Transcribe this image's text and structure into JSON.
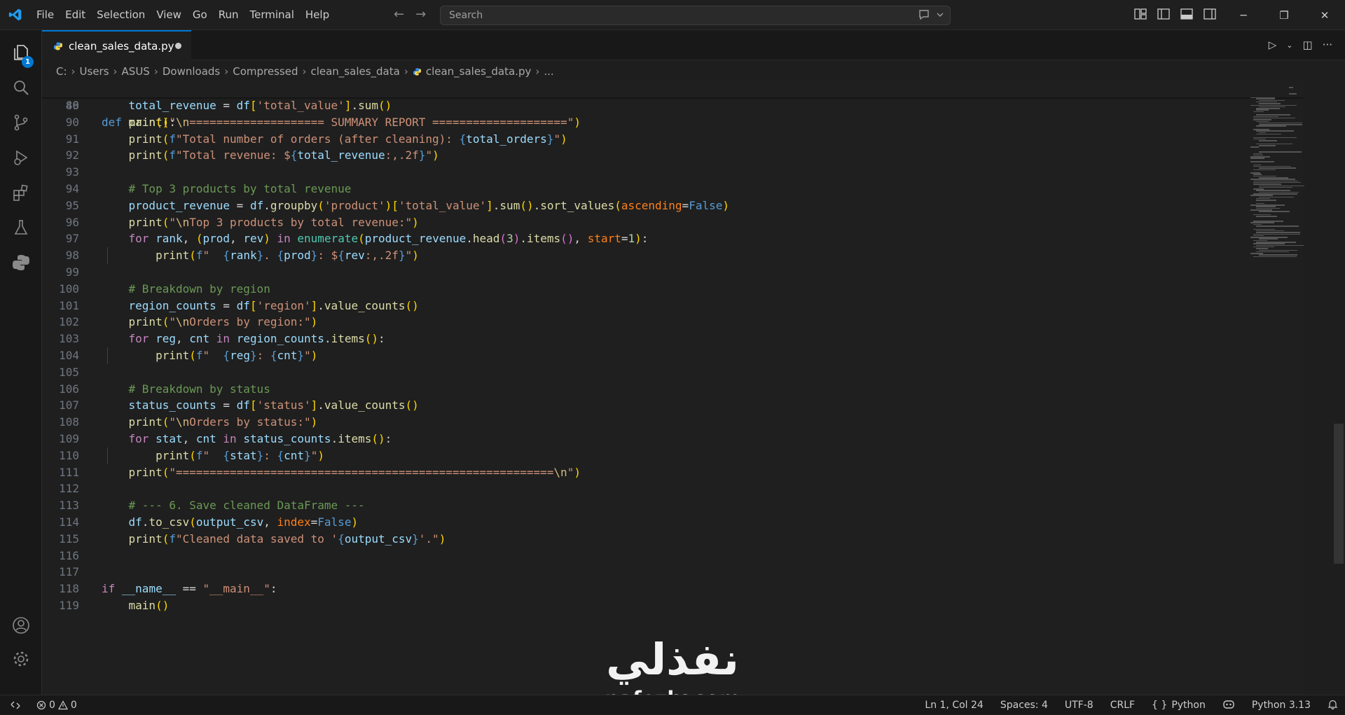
{
  "titlebar": {
    "menu": [
      "File",
      "Edit",
      "Selection",
      "View",
      "Go",
      "Run",
      "Terminal",
      "Help"
    ],
    "search_placeholder": "Search"
  },
  "activitybar": {
    "explorer_badge": "1"
  },
  "tab": {
    "filename": "clean_sales_data.py"
  },
  "breadcrumb": [
    "C:",
    "Users",
    "ASUS",
    "Downloads",
    "Compressed",
    "clean_sales_data",
    "clean_sales_data.py",
    "..."
  ],
  "code": {
    "sticky_line_number": "46",
    "line_numbers": [
      "89",
      "90",
      "91",
      "92",
      "93",
      "94",
      "95",
      "96",
      "97",
      "98",
      "99",
      "100",
      "101",
      "102",
      "103",
      "104",
      "105",
      "106",
      "107",
      "108",
      "109",
      "110",
      "111",
      "112",
      "113",
      "114",
      "115",
      "116",
      "117",
      "118",
      "119"
    ]
  },
  "watermark": {
    "arabic": "نفذلي",
    "latin": "nafezly.com"
  },
  "statusbar": {
    "errors": "0",
    "warnings": "0",
    "position": "Ln 1, Col 24",
    "spaces": "Spaces: 4",
    "encoding": "UTF-8",
    "eol": "CRLF",
    "language": "Python",
    "interpreter": "Python 3.13"
  },
  "colors": {
    "accent": "#0078d4",
    "keyword": "#c586c0",
    "function": "#dcdcaa",
    "string": "#ce9178",
    "comment": "#6a9955"
  }
}
